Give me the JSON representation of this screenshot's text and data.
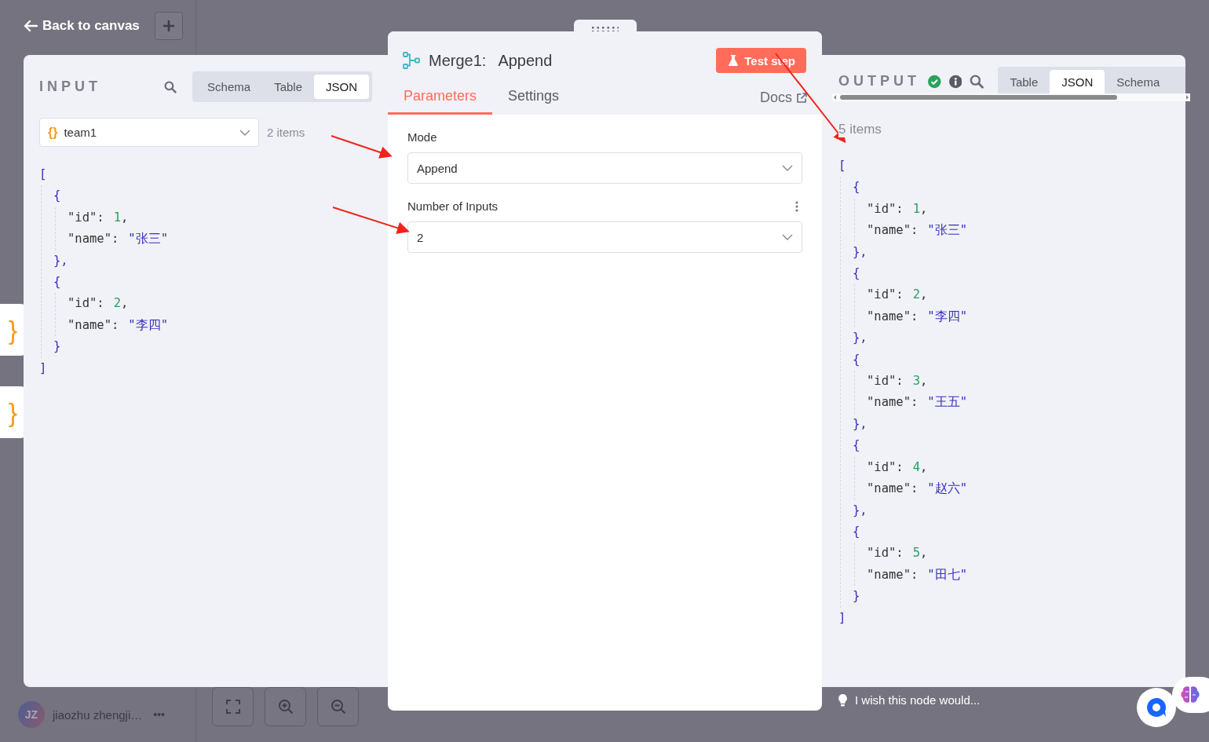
{
  "canvas": {
    "back_link": "Back to canvas",
    "user": {
      "initials": "JZ",
      "name": "jiaozhu zhengji…",
      "more": "•••"
    },
    "side_tabs": [
      {
        "label": "}"
      },
      {
        "label": "}"
      }
    ],
    "hint": "I wish this node would..."
  },
  "input": {
    "title": "INPUT",
    "tabs": [
      {
        "label": "Schema",
        "selected": false
      },
      {
        "label": "Table",
        "selected": false
      },
      {
        "label": "JSON",
        "selected": true
      }
    ],
    "selector": {
      "icon": "{}",
      "value": "team1"
    },
    "count": "2 items",
    "json": {
      "open": "[",
      "close": "]",
      "items": [
        {
          "open": "{",
          "close": "},",
          "fields": [
            {
              "key": "\"id\":",
              "value": "1",
              "kind": "number",
              "tail": ","
            },
            {
              "key": "\"name\":",
              "value": "\"张三\"",
              "kind": "string"
            }
          ]
        },
        {
          "open": "{",
          "close": "}",
          "fields": [
            {
              "key": "\"id\":",
              "value": "2",
              "kind": "number",
              "tail": ","
            },
            {
              "key": "\"name\":",
              "value": "\"李四\"",
              "kind": "string"
            }
          ]
        }
      ]
    }
  },
  "node": {
    "name": "Merge1:",
    "operation": "Append",
    "test_button": "Test step",
    "tabs": [
      {
        "label": "Parameters",
        "selected": true
      },
      {
        "label": "Settings",
        "selected": false
      }
    ],
    "docs": "Docs",
    "parameters": [
      {
        "label": "Mode",
        "value": "Append",
        "has_menu": false
      },
      {
        "label": "Number of Inputs",
        "value": "2",
        "has_menu": true
      }
    ]
  },
  "output": {
    "title": "OUTPUT",
    "tabs": [
      {
        "label": "Table",
        "selected": false
      },
      {
        "label": "JSON",
        "selected": true
      },
      {
        "label": "Schema",
        "selected": false
      }
    ],
    "count": "5 items",
    "json": {
      "open": "[",
      "close": "]",
      "items": [
        {
          "open": "{",
          "close": "},",
          "fields": [
            {
              "key": "\"id\":",
              "value": "1",
              "kind": "number",
              "tail": ","
            },
            {
              "key": "\"name\":",
              "value": "\"张三\"",
              "kind": "string"
            }
          ]
        },
        {
          "open": "{",
          "close": "},",
          "fields": [
            {
              "key": "\"id\":",
              "value": "2",
              "kind": "number",
              "tail": ","
            },
            {
              "key": "\"name\":",
              "value": "\"李四\"",
              "kind": "string"
            }
          ]
        },
        {
          "open": "{",
          "close": "},",
          "fields": [
            {
              "key": "\"id\":",
              "value": "3",
              "kind": "number",
              "tail": ","
            },
            {
              "key": "\"name\":",
              "value": "\"王五\"",
              "kind": "string"
            }
          ]
        },
        {
          "open": "{",
          "close": "},",
          "fields": [
            {
              "key": "\"id\":",
              "value": "4",
              "kind": "number",
              "tail": ","
            },
            {
              "key": "\"name\":",
              "value": "\"赵六\"",
              "kind": "string"
            }
          ]
        },
        {
          "open": "{",
          "close": "}",
          "fields": [
            {
              "key": "\"id\":",
              "value": "5",
              "kind": "number",
              "tail": ","
            },
            {
              "key": "\"name\":",
              "value": "\"田七\"",
              "kind": "string"
            }
          ]
        }
      ]
    }
  }
}
